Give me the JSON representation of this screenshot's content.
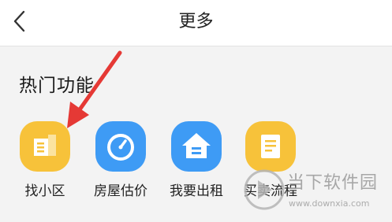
{
  "header": {
    "title": "更多",
    "back_icon": "chevron-left-icon"
  },
  "section": {
    "title": "热门功能"
  },
  "features": [
    {
      "label": "找小区",
      "icon": "building-icon",
      "color": "#f7c23a"
    },
    {
      "label": "房屋估价",
      "icon": "gauge-icon",
      "color": "#3e9bf5"
    },
    {
      "label": "我要出租",
      "icon": "house-icon",
      "color": "#3e9bf5"
    },
    {
      "label": "买卖流程",
      "icon": "document-icon",
      "color": "#f7c23a"
    }
  ],
  "annotation": {
    "arrow_color": "#e53935"
  },
  "watermark": {
    "brand": "当下软件园",
    "url": "www.downxia.com"
  }
}
